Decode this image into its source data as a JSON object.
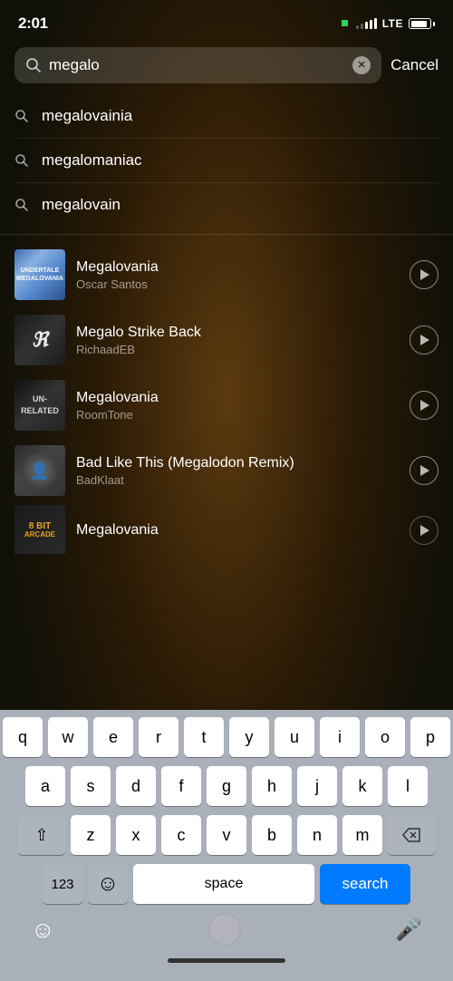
{
  "statusBar": {
    "time": "2:01",
    "lte": "LTE",
    "wifiDot": true
  },
  "search": {
    "placeholder": "Search",
    "currentValue": "megalo",
    "cancelLabel": "Cancel"
  },
  "suggestions": [
    {
      "id": "s1",
      "text": "megalovainia"
    },
    {
      "id": "s2",
      "text": "megalomaniac"
    },
    {
      "id": "s3",
      "text": "megalovain"
    }
  ],
  "songs": [
    {
      "id": "song1",
      "title": "Megalovania",
      "artist": "Oscar Santos",
      "artType": "megalovania1"
    },
    {
      "id": "song2",
      "title": "Megalo Strike Back",
      "artist": "RichaadEB",
      "artType": "megalo-strike"
    },
    {
      "id": "song3",
      "title": "Megalovania",
      "artist": "RoomTone",
      "artType": "megalovania2"
    },
    {
      "id": "song4",
      "title": "Bad Like This (Megalodon Remix)",
      "artist": "BadKlaat",
      "artType": "badlike"
    },
    {
      "id": "song5",
      "title": "Megalovania",
      "artist": "",
      "artType": "8bit"
    }
  ],
  "keyboard": {
    "row1": [
      "q",
      "w",
      "e",
      "r",
      "t",
      "y",
      "u",
      "i",
      "o",
      "p"
    ],
    "row2": [
      "a",
      "s",
      "d",
      "f",
      "g",
      "h",
      "j",
      "k",
      "l"
    ],
    "row3": [
      "z",
      "x",
      "c",
      "v",
      "b",
      "n",
      "m"
    ],
    "spaceLabel": "space",
    "searchLabel": "search",
    "numericLabel": "123"
  }
}
